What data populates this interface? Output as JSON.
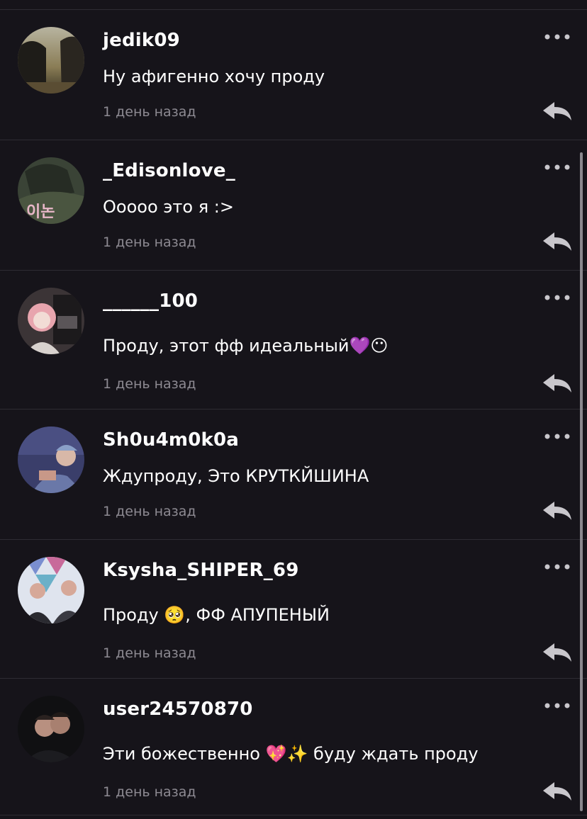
{
  "comments": [
    {
      "username": "jedik09",
      "text": "Ну афигенно хочу проду",
      "time": "1 день назад"
    },
    {
      "username": "_Edisonlove_",
      "text": "Ооооо это я :>",
      "time": "1 день назад"
    },
    {
      "username": "______100",
      "text": "Проду, этот фф идеальный💜😶",
      "time": "1 день назад"
    },
    {
      "username": "Sh0u4m0k0a",
      "text": "Ждупроду, Это КРУТКЙШИНА",
      "time": "1 день назад"
    },
    {
      "username": "Ksysha_SHIPER_69",
      "text": "Проду 🥺, ФФ АПУПЕНЫЙ",
      "time": "1 день назад"
    },
    {
      "username": "user24570870",
      "text": "Эти божественно 💖✨ буду ждать проду",
      "time": "1 день назад"
    }
  ],
  "icons": {
    "more": "more-dots-icon",
    "reply": "reply-arrow-icon"
  },
  "colors": {
    "background": "#16141a",
    "text": "#ffffff",
    "muted": "#8d8a92",
    "divider": "#2e2c33",
    "icon": "#c9c7cc"
  }
}
